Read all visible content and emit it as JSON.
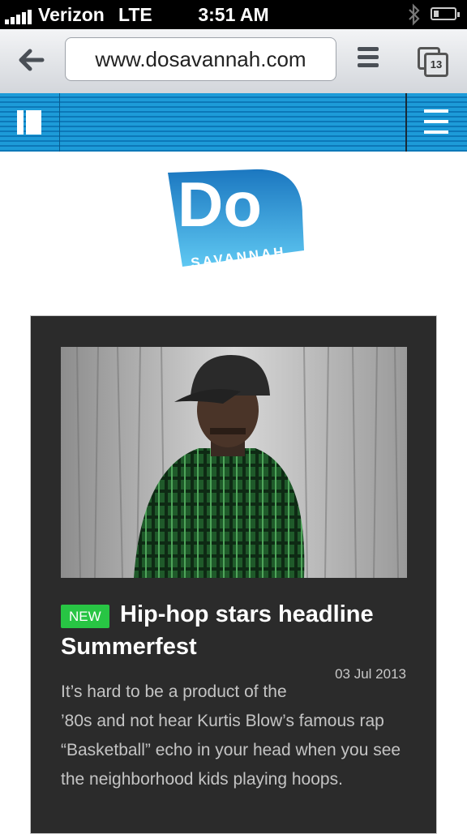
{
  "status_bar": {
    "carrier": "Verizon",
    "network": "LTE",
    "time": "3:51 AM"
  },
  "browser": {
    "url": "www.dosavannah.com",
    "tab_count": "13"
  },
  "logo": {
    "big_letters": "Do",
    "sub_text": "SAVANNAH",
    "gradient_top": "#1b77c0",
    "gradient_bottom": "#5fc8f2"
  },
  "article": {
    "badge": "NEW",
    "headline": "Hip-hop stars headline Summerfest",
    "date": "03 Jul 2013",
    "excerpt": "It’s hard to be a product of the ’80s and not hear Kurtis Blow’s famous rap “Basketball” echo in your head when you see the neighborhood kids playing hoops."
  },
  "colors": {
    "nav_blue": "#1d9bd8",
    "card_bg": "#2b2b2b",
    "badge_green": "#28c544"
  }
}
